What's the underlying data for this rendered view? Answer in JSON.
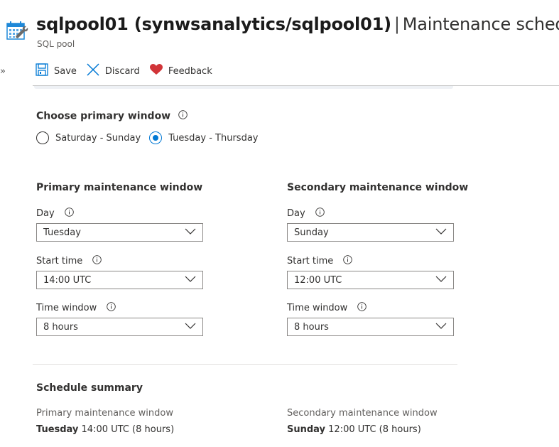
{
  "header": {
    "resource_name": "sqlpool01 (synwsanalytics/sqlpool01)",
    "separator": "|",
    "blade_title": "Maintenance schedule",
    "subtitle": "SQL pool",
    "icon": "calendar-wrench-icon"
  },
  "sidebar": {
    "expand_glyph": "»"
  },
  "toolbar": {
    "save_label": "Save",
    "discard_label": "Discard",
    "feedback_label": "Feedback"
  },
  "primary_window_choice": {
    "label": "Choose primary window",
    "options": [
      {
        "label": "Saturday - Sunday",
        "selected": false
      },
      {
        "label": "Tuesday - Thursday",
        "selected": true
      }
    ]
  },
  "primary": {
    "title": "Primary maintenance window",
    "day_label": "Day",
    "day_value": "Tuesday",
    "start_label": "Start time",
    "start_value": "14:00 UTC",
    "window_label": "Time window",
    "window_value": "8 hours"
  },
  "secondary": {
    "title": "Secondary maintenance window",
    "day_label": "Day",
    "day_value": "Sunday",
    "start_label": "Start time",
    "start_value": "12:00 UTC",
    "window_label": "Time window",
    "window_value": "8 hours"
  },
  "summary": {
    "title": "Schedule summary",
    "primary_label": "Primary maintenance window",
    "primary_day": "Tuesday",
    "primary_rest": " 14:00 UTC (8 hours)",
    "secondary_label": "Secondary maintenance window",
    "secondary_day": "Sunday",
    "secondary_rest": " 12:00 UTC (8 hours)"
  },
  "colors": {
    "accent": "#0078d4",
    "heart": "#d13438"
  }
}
